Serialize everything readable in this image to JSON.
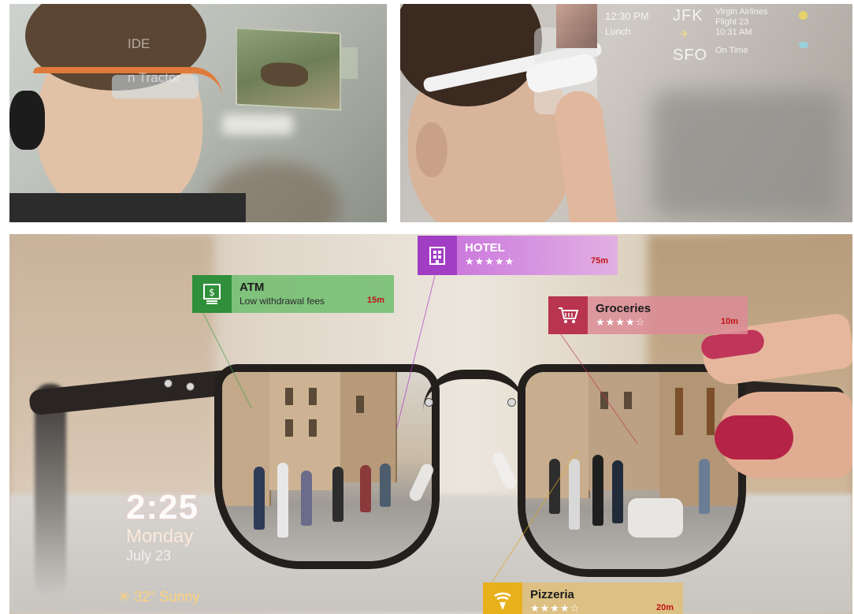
{
  "top_left": {
    "hud_text_line1": "IDE",
    "hud_text_line2": "n Tractor"
  },
  "top_right": {
    "time": "12:30 PM",
    "event": "Lunch",
    "origin": "JFK",
    "destination": "SFO",
    "airline": "Virgin Airlines",
    "flight": "Flight 23",
    "depart_time": "10:31 AM",
    "status": "On Time"
  },
  "bottom": {
    "clock": "2:25",
    "day": "Monday",
    "date": "July 23",
    "weather": "32° Sunny",
    "tags": {
      "atm": {
        "name": "ATM",
        "sub": "Low withdrawal fees",
        "distance": "15m",
        "icon": "dollar-atm-icon",
        "color": "#2f8f3a"
      },
      "hotel": {
        "name": "HOTEL",
        "stars": "★★★★★",
        "distance": "75m",
        "icon": "building-icon",
        "color": "#a13ec4"
      },
      "groceries": {
        "name": "Groceries",
        "stars": "★★★★☆",
        "distance": "10m",
        "icon": "shopping-cart-icon",
        "color": "#b8344f"
      },
      "pizzeria": {
        "name": "Pizzeria",
        "stars": "★★★★☆",
        "distance": "20m",
        "icon": "pizza-wifi-icon",
        "color": "#e8b11c"
      }
    }
  }
}
